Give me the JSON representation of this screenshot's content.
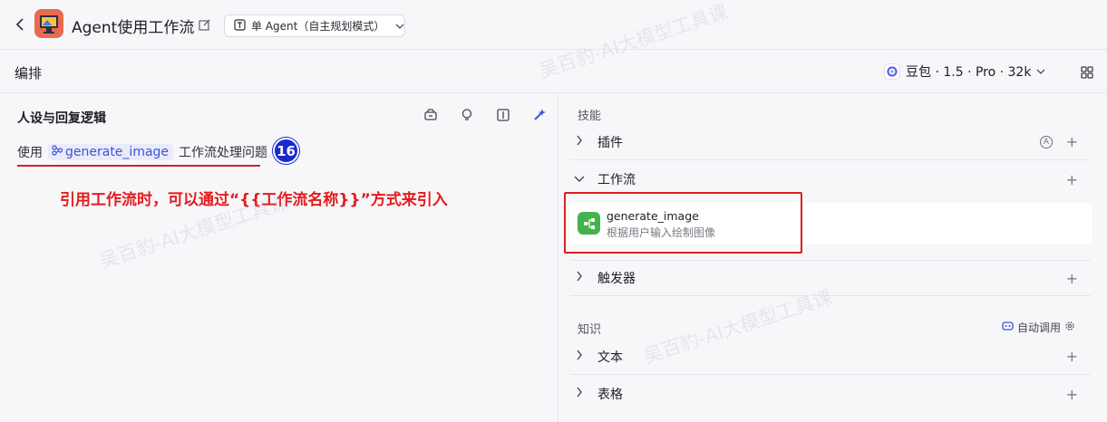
{
  "header": {
    "back_label": "‹",
    "title": "Agent使用工作流",
    "mode_label": "单 Agent（自主规划模式）"
  },
  "subbar": {
    "title": "编排",
    "model_label": "豆包 · 1.5 · Pro · 32k"
  },
  "left": {
    "section_title": "人设与回复逻辑",
    "prompt_prefix": "使用",
    "prompt_chip": "generate_image",
    "prompt_suffix": "工作流处理问题",
    "step_badge": "16",
    "annotation": "引用工作流时，可以通过“{{工作流名称}}”方式来引入"
  },
  "right": {
    "skills_title": "技能",
    "plugins_label": "插件",
    "workflow_label": "工作流",
    "workflow_item": {
      "name": "generate_image",
      "description": "根据用户输入绘制图像"
    },
    "trigger_label": "触发器",
    "knowledge_title": "知识",
    "auto_call_label": "自动调用",
    "text_label": "文本",
    "table_label": "表格"
  },
  "watermark_text": "吴百豹-AI大模型工具课",
  "colors": {
    "accent_blue": "#4152d8",
    "annotation_red": "#e31b1b",
    "badge_blue": "#1a2ad1",
    "workflow_green": "#43b34c"
  }
}
